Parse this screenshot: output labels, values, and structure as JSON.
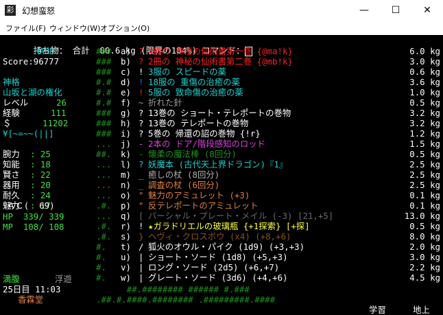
{
  "window": {
    "title": "幻想蛮怒",
    "icon_glyph": "彩",
    "minimize": "—",
    "maximize": "☐",
    "close": "✕"
  },
  "menubar": [
    "ファイル(F)",
    "ウィンドウ(W)",
    "オプション(O)"
  ],
  "header": "持ち物： 合計  80.6 kg (限界の104%) コマンド：",
  "status": {
    "difficulty": "HARD",
    "score": "Score:96777",
    "race": "神格",
    "class": "山坂と湖の権化",
    "level_label": "レベル",
    "level": "26",
    "exp_label": "経験",
    "exp": "111",
    "gold_label": "＄",
    "gold": "11202",
    "equip": "¥[~=~~(||]",
    "stats": [
      {
        "label": "腕力",
        "value": ": 25"
      },
      {
        "label": "知能",
        "value": ": 18"
      },
      {
        "label": "賢さ",
        "value": ": 22"
      },
      {
        "label": "器用",
        "value": ": 20"
      },
      {
        "label": "耐久",
        "value": ": 24"
      },
      {
        "label": "魅力",
        "value": ": 17"
      }
    ],
    "ac": "ＡＣ(  69)",
    "hp": "HP  339/ 339",
    "mp": "MP  108/ 108",
    "hunger": "満腹",
    "float": "浮遊",
    "date": "25日目 11:03",
    "location": "香霖堂",
    "depth_label": "学習",
    "surface": "地上"
  },
  "inventory": [
    {
      "key": "a)",
      "sym": "?",
      "name": "4冊の 神秘の仙術書第一巻 {@ma!k}",
      "weight": "6.0 kg",
      "color": "#ff2020",
      "sym_color": "#ff2020"
    },
    {
      "key": "b)",
      "sym": "?",
      "name": "2冊の 神秘の仙術書第二巻 {@mb!k}",
      "weight": "3.0 kg",
      "color": "#ff2020",
      "sym_color": "#ff2020"
    },
    {
      "key": "c)",
      "sym": "!",
      "name": "3服の スピードの薬",
      "weight": "0.6 kg",
      "color": "#20d0d0",
      "sym_color": "#ffffff"
    },
    {
      "key": "d)",
      "sym": "!",
      "name": "18服の 重傷の治癒の薬",
      "weight": "3.6 kg",
      "color": "#20d0d0",
      "sym_color": "#3060ff"
    },
    {
      "key": "e)",
      "sym": "!",
      "name": "5服の 致命傷の治癒の薬",
      "weight": "1.0 kg",
      "color": "#20d0d0",
      "sym_color": "#ff2020"
    },
    {
      "key": "f)",
      "sym": "~",
      "name": "折れた針",
      "weight": "0.5 kg",
      "color": "#9a9a9a",
      "sym_color": "#9a9a9a"
    },
    {
      "key": "g)",
      "sym": "?",
      "name": "13巻の ショート・テレポートの巻物",
      "weight": "3.2 kg",
      "color": "#ffffff",
      "sym_color": "#ffffff"
    },
    {
      "key": "h)",
      "sym": "?",
      "name": "13巻の テレポートの巻物",
      "weight": "3.2 kg",
      "color": "#ffffff",
      "sym_color": "#ffffff"
    },
    {
      "key": "i)",
      "sym": "?",
      "name": "5巻の 帰還の詔の巻物 {!r}",
      "weight": "1.2 kg",
      "color": "#ffffff",
      "sym_color": "#ffffff"
    },
    {
      "key": "j)",
      "sym": "-",
      "name": "2本の ドア/階段感知のロッド",
      "weight": "1.5 kg",
      "color": "#e040e0",
      "sym_color": "#e040e0"
    },
    {
      "key": "k)",
      "sym": "-",
      "name": "懐柔の魔法棒 (8回分)",
      "weight": "0.5 kg",
      "color": "#1f8f1f",
      "sym_color": "#1f8f1f"
    },
    {
      "key": "l)",
      "sym": "?",
      "name": "妖魔本 (古代天上界ドラゴン)『1』",
      "weight": "2.5 kg",
      "color": "#20d0d0",
      "sym_color": "#20d0d0"
    },
    {
      "key": "m)",
      "sym": "_",
      "name": "癒しの杖 (8回分)",
      "weight": "2.5 kg",
      "color": "#b0b0b0",
      "sym_color": "#b0b0b0"
    },
    {
      "key": "n)",
      "sym": "_",
      "name": "調査の杖 (6回分)",
      "weight": "2.5 kg",
      "color": "#e08040",
      "sym_color": "#e08040"
    },
    {
      "key": "o)",
      "sym": "\"",
      "name": "魅力のアミュレット (+3)",
      "weight": "0.1 kg",
      "color": "#e08040",
      "sym_color": "#e08040"
    },
    {
      "key": "p)",
      "sym": "\"",
      "name": "反テレポートのアミュレット",
      "weight": "0.1 kg",
      "color": "#e08040",
      "sym_color": "#e08040"
    },
    {
      "key": "q)",
      "sym": "[",
      "name": "バーシャル・プレート・メイル (-3) [21,+5]",
      "weight": "13.0 kg",
      "color": "#6a6a6a",
      "sym_color": "#6a6a6a"
    },
    {
      "key": "r)",
      "sym": "!",
      "name": "★ガラドリエルの玻璃瓶 {+1探索} [+探]",
      "weight": "0.5 kg",
      "color": "#ffff40",
      "sym_color": "#ffffff"
    },
    {
      "key": "s)",
      "sym": "}",
      "name": "ヘヴィ・クロスボウ (x4) (+8,+6)",
      "weight": "8.0 kg",
      "color": "#8a5020",
      "sym_color": "#8a5020"
    },
    {
      "key": "t)",
      "sym": "/",
      "name": "狐火のオウル・パイク (1d9) (+3,+3)",
      "weight": "2.0 kg",
      "color": "#ffffff",
      "sym_color": "#ffffff"
    },
    {
      "key": "u)",
      "sym": "|",
      "name": "ショート・ソード (1d8) (+5,+3)",
      "weight": "3.0 kg",
      "color": "#ffffff",
      "sym_color": "#ffffff"
    },
    {
      "key": "v)",
      "sym": "|",
      "name": "ロング・ソード (2d5) (+6,+7)",
      "weight": "2.2 kg",
      "color": "#ffffff",
      "sym_color": "#ffffff"
    },
    {
      "key": "w)",
      "sym": "|",
      "name": "グレート・ソード (3d6) (+4,+6)",
      "weight": "4.5 kg",
      "color": "#ffffff",
      "sym_color": "#ffffff"
    }
  ],
  "map_fragments": [
    "###",
    "###",
    "###",
    "#.#",
    "#.#",
    "#.#",
    "###",
    "###",
    "###",
    "...",
    "##.",
    "...",
    "...",
    "...",
    "...",
    ".#.",
    "...",
    ".#.",
    ".#.",
    "#.",
    "#.",
    "#.",
    "#."
  ],
  "bottom_rows": [
    "      ##.######## ###### #.###",
    ".##.#.####.######## .#########.####"
  ],
  "colors": {
    "terminal_bg": "#000000",
    "white": "#ffffff",
    "green": "#1f8f1f",
    "cyan": "#20d0d0",
    "bright_green": "#40e040",
    "yellow": "#ffff40",
    "orange": "#e08040"
  }
}
